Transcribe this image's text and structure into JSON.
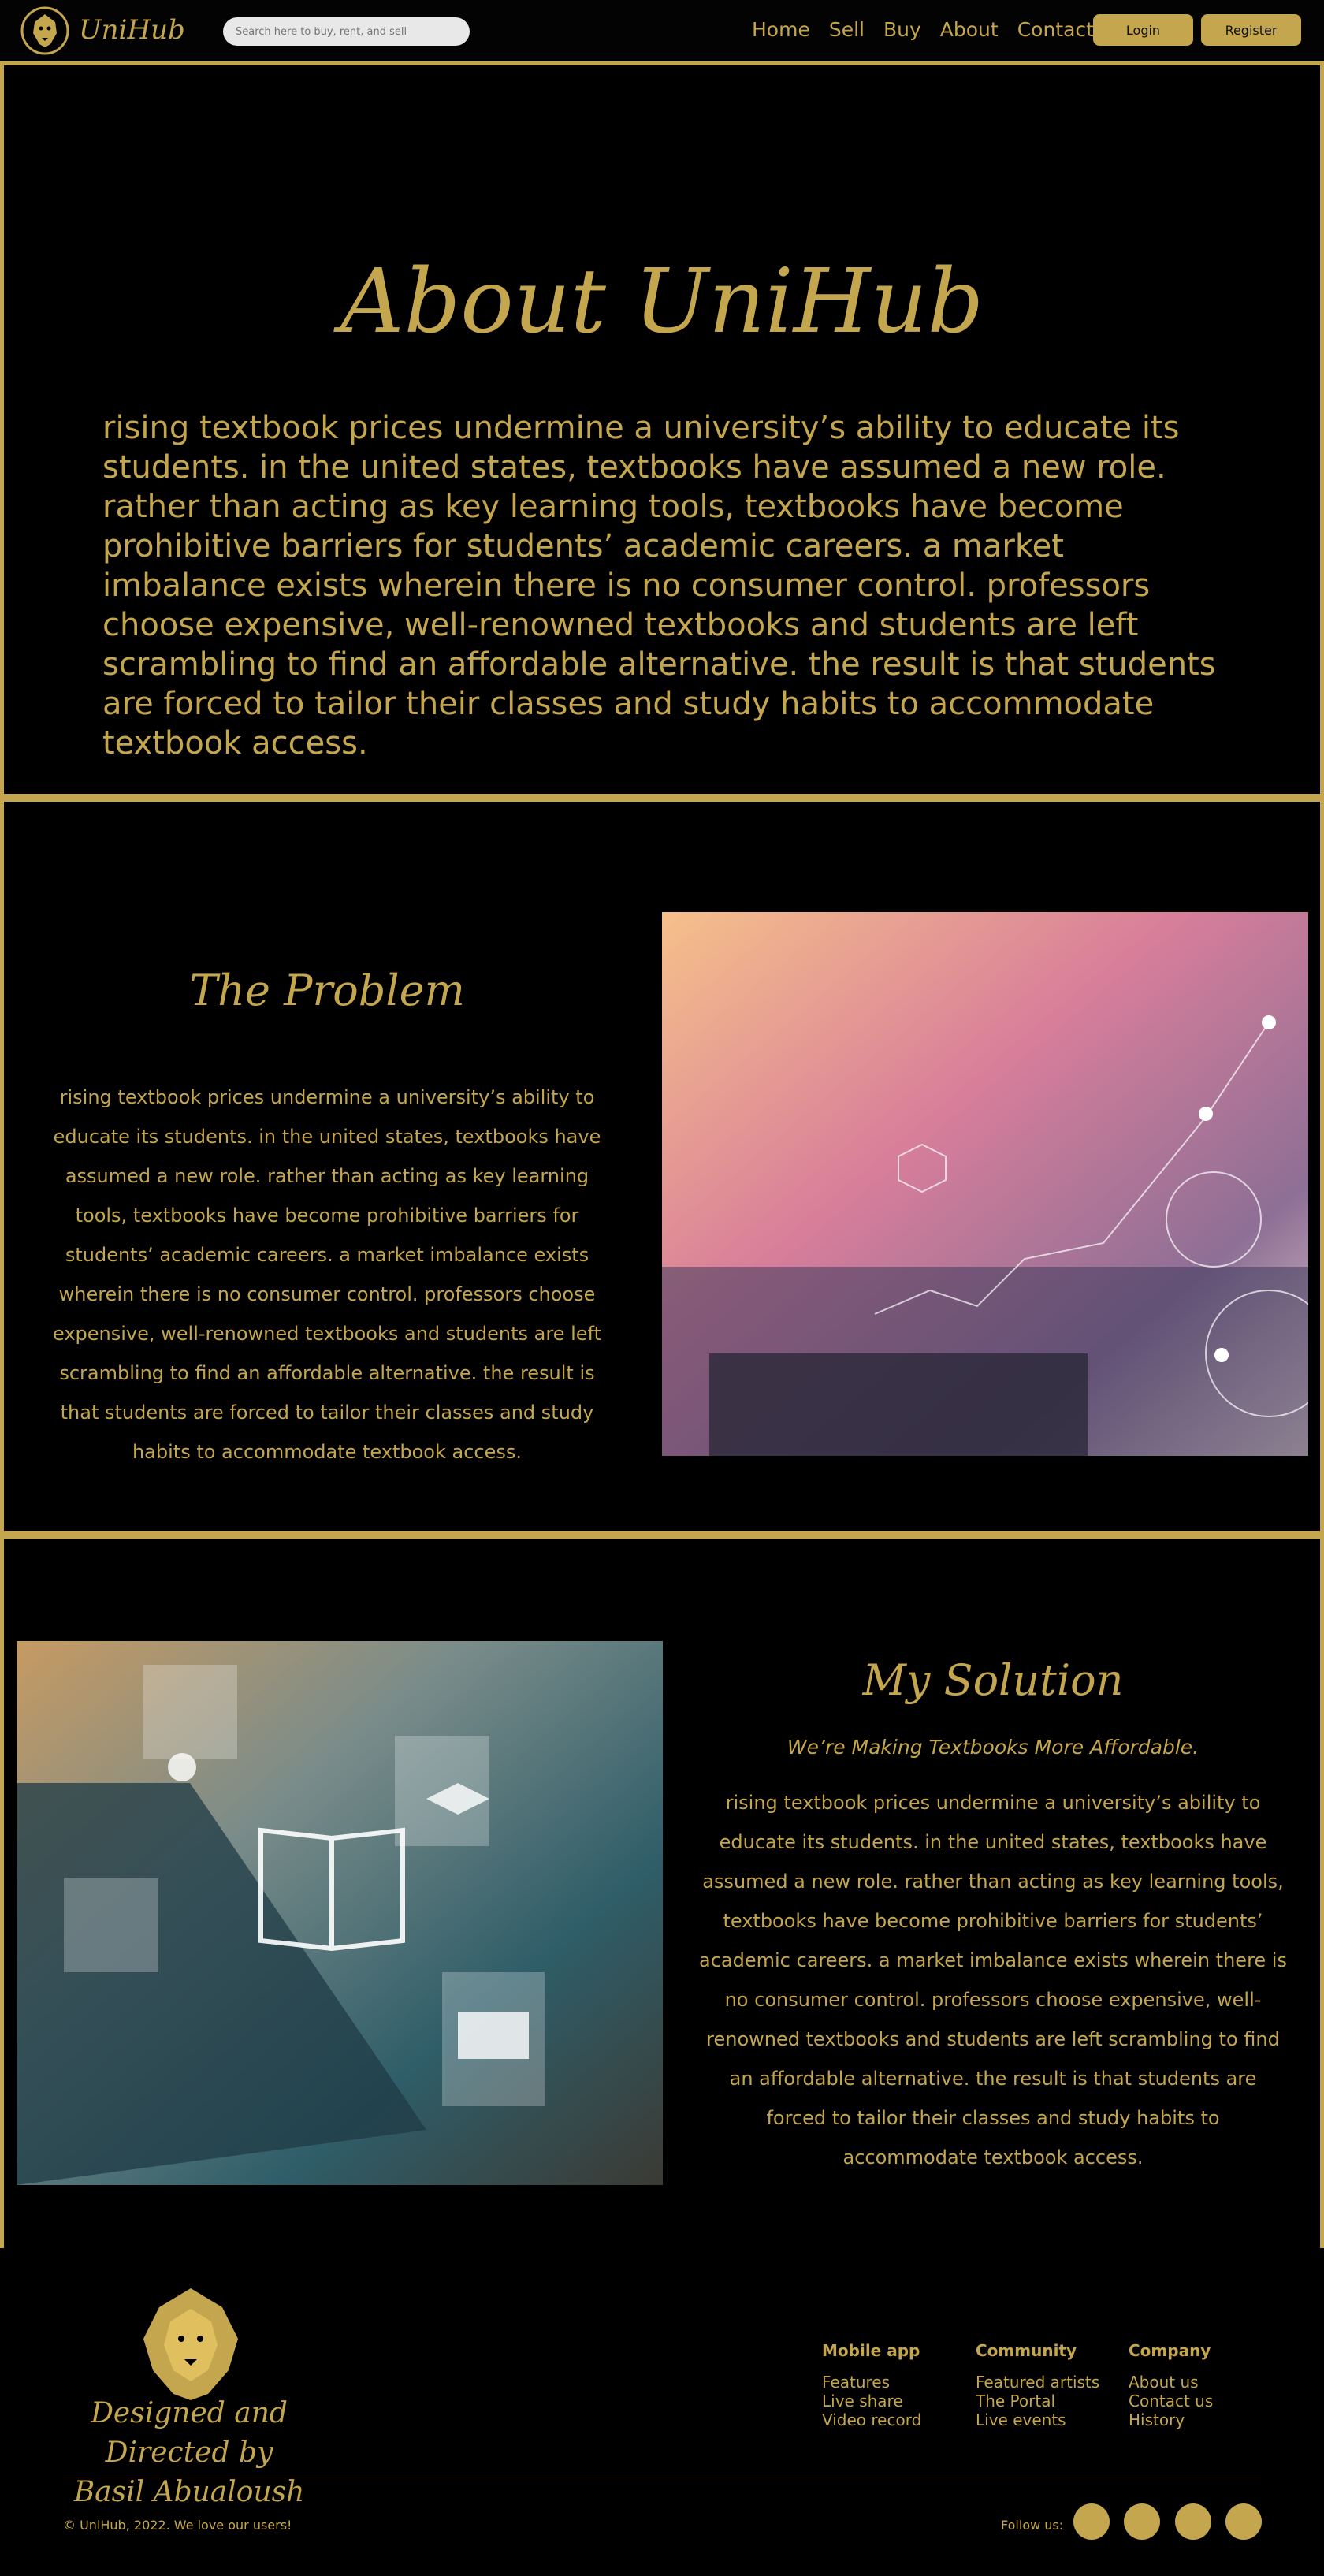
{
  "nav": {
    "brand": "UniHub",
    "search_placeholder": "Search here to buy, rent, and sell",
    "links": [
      "Home",
      "Sell",
      "Buy",
      "About",
      "Contact"
    ],
    "login_label": "Login",
    "register_label": "Register"
  },
  "about": {
    "title": "About UniHub",
    "body": "rising textbook prices undermine a university’s ability to educate its students. in the united states, textbooks have assumed a new role. rather than acting as key learning tools, textbooks have become prohibitive barriers for students’ academic careers. a market imbalance exists wherein there is no consumer control. professors choose expensive, well-renowned textbooks and students are left scrambling to find an affordable alternative. the result is that students are forced to tailor their classes and study habits to accommodate textbook access."
  },
  "problem": {
    "title": "The Problem",
    "body": "rising textbook prices undermine a university’s ability to educate its students. in the united states, textbooks have assumed a new role. rather than acting as key learning tools, textbooks have become prohibitive barriers for students’ academic careers. a market imbalance exists wherein there is no consumer control. professors choose expensive, well-renowned textbooks and students are left scrambling to find an affordable alternative. the result is that students are forced to tailor their classes and study habits to accommodate textbook access."
  },
  "solution": {
    "title": "My Solution",
    "subtitle": "We’re Making Textbooks More Affordable.",
    "body": "rising textbook prices undermine a university’s ability to educate its students. in the united states, textbooks have assumed a new role. rather than acting as key learning tools, textbooks have become prohibitive barriers for students’ academic careers. a market imbalance exists wherein there is no consumer control. professors choose expensive, well-renowned textbooks and students are left scrambling to find an affordable alternative. the result is that students are forced to tailor their classes and study habits to accommodate textbook access."
  },
  "footer": {
    "signature_line1": "Designed and Directed by",
    "signature_line2": "Basil Abualoush",
    "columns": [
      {
        "heading": "Mobile app",
        "links": [
          "Features",
          "Live share",
          "Video record"
        ]
      },
      {
        "heading": "Community",
        "links": [
          "Featured artists",
          "The Portal",
          "Live events"
        ]
      },
      {
        "heading": "Company",
        "links": [
          "About us",
          "Contact us",
          "History"
        ]
      }
    ],
    "copyright": "© UniHub, 2022. We love our users!",
    "follow_label": "Follow us:",
    "social_icons": [
      "social-icon-1",
      "social-icon-2",
      "social-icon-3",
      "social-icon-4"
    ]
  },
  "colors": {
    "accent": "#c4a64f",
    "background": "#000000"
  }
}
